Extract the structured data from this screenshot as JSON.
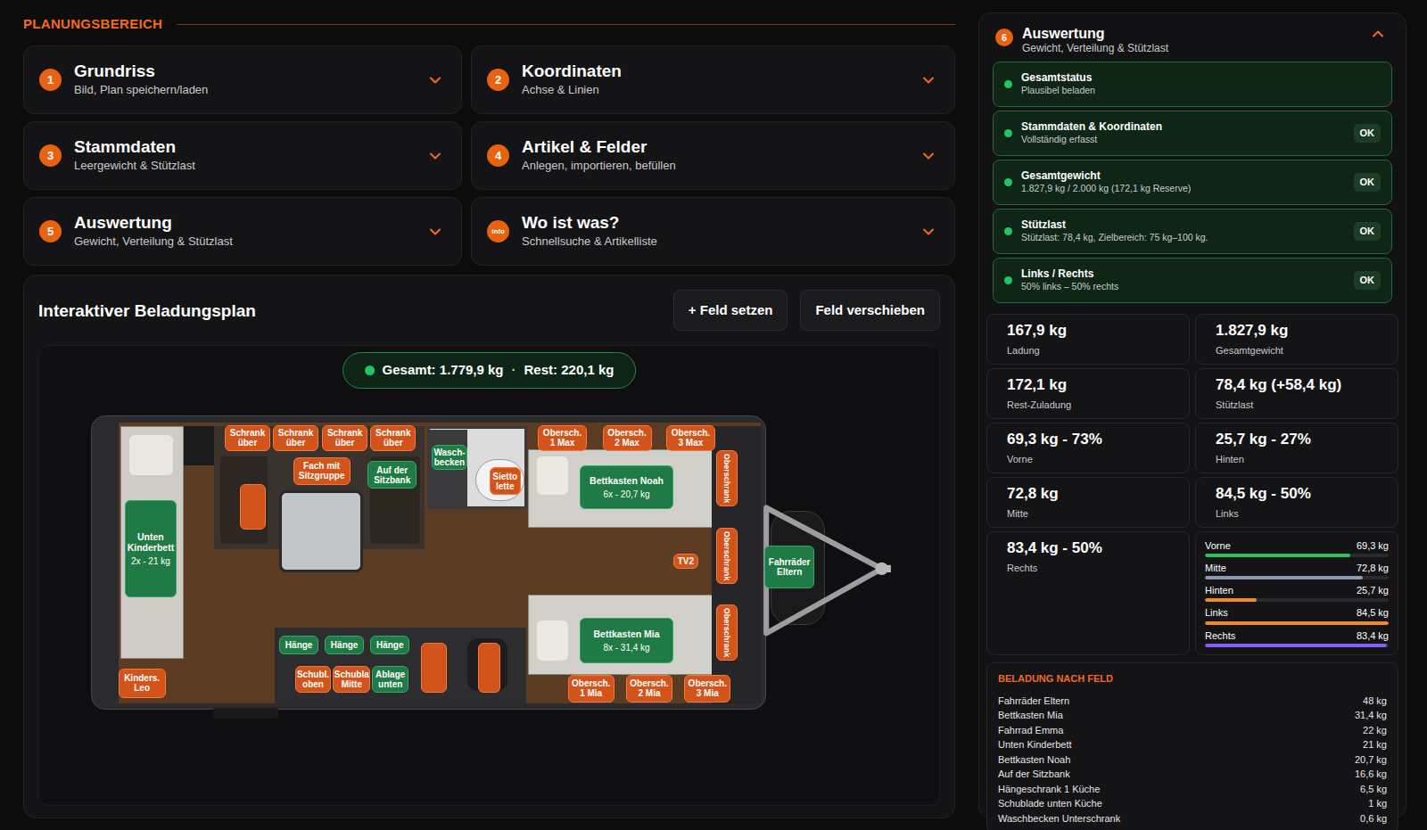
{
  "area_title": "PLANUNGSBEREICH",
  "sections": [
    {
      "number": "1",
      "title": "Grundriss",
      "subtitle": "Bild, Plan speichern/laden",
      "expanded": false
    },
    {
      "number": "2",
      "title": "Koordinaten",
      "subtitle": "Achse & Linien",
      "expanded": false
    },
    {
      "number": "3",
      "title": "Stammdaten",
      "subtitle": "Leergewicht & Stützlast",
      "expanded": false
    },
    {
      "number": "4",
      "title": "Artikel & Felder",
      "subtitle": "Anlegen, importieren, befüllen",
      "expanded": false
    },
    {
      "number": "5",
      "title": "Auswertung",
      "subtitle": "Gewicht, Verteilung & Stützlast",
      "expanded": false
    },
    {
      "number": "info",
      "title": "Wo ist was?",
      "subtitle": "Schnellsuche & Artikelliste",
      "expanded": false
    }
  ],
  "plan": {
    "title": "Interaktiver Beladungsplan",
    "buttons": [
      "+ Feld setzen",
      "Feld verschieben"
    ],
    "summary": {
      "total": "Gesamt: 1.779,9 kg",
      "separator": "·",
      "rest": "Rest: 220,1 kg",
      "status_color": "#22c55e"
    },
    "fields": [
      {
        "kind": "box",
        "label": "Schrank über",
        "filled": false
      },
      {
        "kind": "box",
        "label": "Schrank über",
        "filled": false
      },
      {
        "kind": "box",
        "label": "Schrank über",
        "filled": false
      },
      {
        "kind": "box",
        "label": "Schrank über",
        "filled": false
      },
      {
        "kind": "box",
        "label": "Fach mit Sitzgruppe",
        "filled": false
      },
      {
        "kind": "box",
        "label": "Auf der Sitzbank",
        "filled": true
      },
      {
        "kind": "box",
        "label": "Wasch-becken",
        "filled": true
      },
      {
        "kind": "box",
        "label": "Sietto lette",
        "filled": false
      },
      {
        "kind": "box",
        "label": "Obersch. 1 Max",
        "filled": false
      },
      {
        "kind": "box",
        "label": "Obersch. 2 Max",
        "filled": false
      },
      {
        "kind": "box",
        "label": "Obersch. 3 Max",
        "filled": false
      },
      {
        "kind": "box",
        "label": "Bettkasten Noah",
        "detail": "6x - 20,7 kg",
        "filled": true
      },
      {
        "kind": "vertical",
        "label": "Oberschrank",
        "filled": false
      },
      {
        "kind": "vertical",
        "label": "Oberschrank",
        "filled": false
      },
      {
        "kind": "vertical",
        "label": "Oberschrank",
        "filled": false
      },
      {
        "kind": "box",
        "label": "TV2",
        "filled": false
      },
      {
        "kind": "box",
        "label": "Fahrräder Eltern",
        "filled": true
      },
      {
        "kind": "box",
        "label": "Bettkasten Mia",
        "detail": "8x - 31,4 kg",
        "filled": true
      },
      {
        "kind": "box",
        "label": "Obersch. 1 Mia",
        "filled": false
      },
      {
        "kind": "box",
        "label": "Obersch. 2 Mia",
        "filled": false
      },
      {
        "kind": "box",
        "label": "Obersch. 3 Mia",
        "filled": false
      },
      {
        "kind": "box",
        "label": "Unten Kinderbett",
        "detail": "2x - 21 kg",
        "filled": true
      },
      {
        "kind": "box",
        "label": "Kinders. Leo",
        "filled": false
      },
      {
        "kind": "blank",
        "filled": false
      },
      {
        "kind": "box",
        "label": "Hänge",
        "filled": true
      },
      {
        "kind": "box",
        "label": "Hänge",
        "filled": true
      },
      {
        "kind": "box",
        "label": "Hänge",
        "filled": true
      },
      {
        "kind": "box",
        "label": "Schubl. oben",
        "filled": false
      },
      {
        "kind": "box",
        "label": "Schubla Mitte",
        "filled": false
      },
      {
        "kind": "box",
        "label": "Ablage unten",
        "filled": true
      },
      {
        "kind": "blank",
        "filled": false
      },
      {
        "kind": "blank",
        "filled": false
      }
    ]
  },
  "evaluation": {
    "number": "6",
    "title": "Auswertung",
    "subtitle": "Gewicht, Verteilung & Stützlast",
    "expanded": true,
    "checks": [
      {
        "title": "Gesamtstatus",
        "detail": "Plausibel beladen",
        "ok": true
      },
      {
        "title": "Stammdaten & Koordinaten",
        "detail": "Vollständig erfasst",
        "badge": "OK",
        "ok": true
      },
      {
        "title": "Gesamtgewicht",
        "detail": "1.827,9 kg / 2.000 kg (172,1 kg Reserve)",
        "badge": "OK",
        "ok": true
      },
      {
        "title": "Stützlast",
        "detail": "Stützlast: 78,4 kg, Zielbereich: 75 kg–100 kg.",
        "badge": "OK",
        "ok": true
      },
      {
        "title": "Links / Rechts",
        "detail": "50% links – 50% rechts",
        "badge": "OK",
        "ok": true
      }
    ],
    "stats": [
      {
        "value": "167,9 kg",
        "label": "Ladung"
      },
      {
        "value": "1.827,9 kg",
        "label": "Gesamtgewicht"
      },
      {
        "value": "172,1 kg",
        "label": "Rest-Zuladung"
      },
      {
        "value": "78,4 kg (+58,4 kg)",
        "label": "Stützlast"
      },
      {
        "value": "69,3 kg - 73%",
        "label": "Vorne"
      },
      {
        "value": "25,7 kg - 27%",
        "label": "Hinten"
      },
      {
        "value": "72,8 kg",
        "label": "Mitte"
      },
      {
        "value": "84,5 kg - 50%",
        "label": "Links"
      },
      {
        "value": "83,4 kg - 50%",
        "label": "Rechts"
      }
    ],
    "bars": [
      {
        "label": "Vorne",
        "reading": "69,3 kg",
        "level": 0.79,
        "color": "#22c55e"
      },
      {
        "label": "Mitte",
        "reading": "72,8 kg",
        "level": 0.86,
        "color": "#8b98ad"
      },
      {
        "label": "Hinten",
        "reading": "25,7 kg",
        "level": 0.28,
        "color": "#f08a24"
      },
      {
        "label": "Links",
        "reading": "84,5 kg",
        "level": 1.0,
        "color": "#f08a24"
      },
      {
        "label": "Rechts",
        "reading": "83,4 kg",
        "level": 0.99,
        "color": "#8b5cf6"
      }
    ],
    "load_list": {
      "title": "BELADUNG NACH FELD",
      "rows": [
        {
          "name": "Fahrräder Eltern",
          "weight": "48 kg"
        },
        {
          "name": "Bettkasten Mia",
          "weight": "31,4 kg"
        },
        {
          "name": "Fahrrad Emma",
          "weight": "22 kg"
        },
        {
          "name": "Unten Kinderbett",
          "weight": "21 kg"
        },
        {
          "name": "Bettkasten Noah",
          "weight": "20,7 kg"
        },
        {
          "name": "Auf der Sitzbank",
          "weight": "16,6 kg"
        },
        {
          "name": "Hängeschrank 1 Küche",
          "weight": "6,5 kg"
        },
        {
          "name": "Schublade unten Küche",
          "weight": "1 kg"
        },
        {
          "name": "Waschbecken Unterschrank",
          "weight": "0,6 kg"
        }
      ]
    }
  }
}
